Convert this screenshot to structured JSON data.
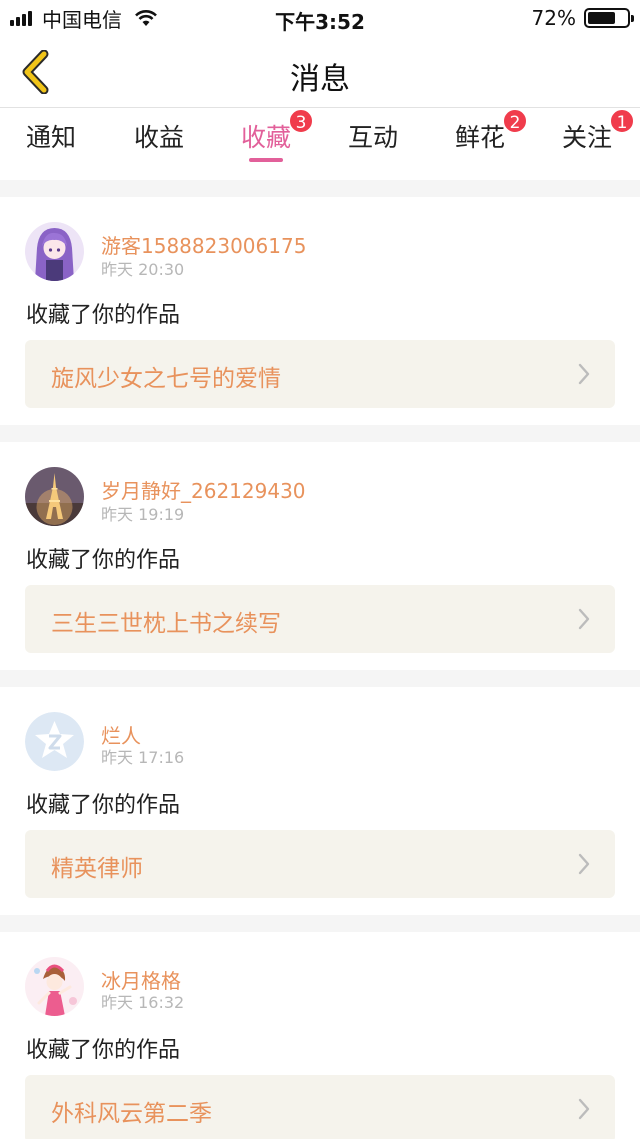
{
  "status_bar": {
    "carrier": "中国电信",
    "time": "下午3:52",
    "battery_percent": "72%",
    "battery_level": 0.72,
    "signal_icon": "signal-bars-icon",
    "wifi_icon": "wifi-icon"
  },
  "nav": {
    "title": "消息",
    "back_icon": "chevron-left-icon",
    "back_color": "#f0c419"
  },
  "tabs": [
    {
      "label": "通知",
      "badge": ""
    },
    {
      "label": "收益",
      "badge": ""
    },
    {
      "label": "收藏",
      "badge": "3",
      "active": true
    },
    {
      "label": "互动",
      "badge": ""
    },
    {
      "label": "鲜花",
      "badge": "2"
    },
    {
      "label": "关注",
      "badge": "1"
    }
  ],
  "accent_color": "#e2609a",
  "badge_color": "#f03c4c",
  "messages": [
    {
      "user": "游客1588823006175",
      "time": "昨天 20:30",
      "text": "收藏了你的作品",
      "work": "旋风少女之七号的爱情",
      "avatar": "anime-girl-avatar"
    },
    {
      "user": "岁月静好_262129430",
      "time": "昨天 19:19",
      "text": "收藏了你的作品",
      "work": "三生三世枕上书之续写",
      "avatar": "eiffel-tower-avatar"
    },
    {
      "user": "烂人",
      "time": "昨天 17:16",
      "text": "收藏了你的作品",
      "work": "精英律师",
      "avatar": "qq-default-avatar"
    },
    {
      "user": "冰月格格",
      "time": "昨天 16:32",
      "text": "收藏了你的作品",
      "work": "外科风云第二季",
      "avatar": "anime-pink-girl-avatar"
    }
  ]
}
